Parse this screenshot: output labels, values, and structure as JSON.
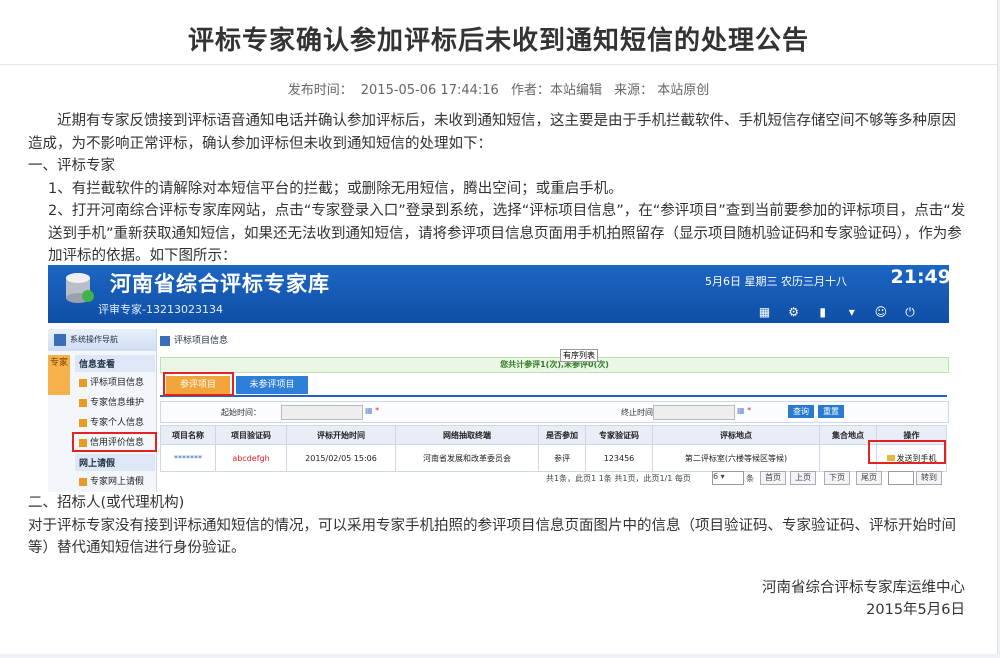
{
  "article": {
    "title": "评标专家确认参加评标后未收到通知短信的处理公告",
    "publish_label": "发布时间：",
    "publish_time": "2015-05-06 17:44:16",
    "author": "作者：本站编辑",
    "source": "来源： 本站原创"
  },
  "body": {
    "intro": "近期有专家反馈接到评标语音通知电话并确认参加评标后，未收到通知短信，这主要是由于手机拦截软件、手机短信存储空间不够等多种原因造成，为不影响正常评标，确认参加评标但未收到通知短信的处理如下：",
    "sec1": "一、评标专家",
    "item1": "1、有拦截软件的请解除对本短信平台的拦截；或删除无用短信，腾出空间；或重启手机。",
    "item2": "2、打开河南综合评标专家库网站，点击“专家登录入口”登录到系统，选择“评标项目信息”，在“参评项目”查到当前要参加的评标项目，点击“发送到手机”重新获取通知短信，如果还无法收到通知短信，请将参评项目信息页面用手机拍照留存（显示项目随机验证码和专家验证码），作为参加评标的依据。如下图所示：",
    "sec2": "二、招标人(或代理机构)",
    "para2": "对于评标专家没有接到评标通知短信的情况，可以采用专家手机拍照的参评项目信息页面图片中的信息（项目验证码、专家验证码、评标开始时间等）替代通知短信进行身份验证。"
  },
  "footer": {
    "org": "河南省综合评标专家库运维中心",
    "date": "2015年5月6日"
  },
  "screenshot": {
    "app_title": "河南省综合评标专家库",
    "user": "评审专家-13213023134",
    "date_text": "5月6日 星期三 农历三月十八",
    "clock": "21:49",
    "side_title": "系统操作导航",
    "side_tab": "专家",
    "menu_group1": "信息查看",
    "menu_items1": [
      "评标项目信息",
      "专家信息维护",
      "专家个人信息",
      "信用评价信息"
    ],
    "menu_group2": "网上请假",
    "menu_items2": [
      "专家网上请假"
    ],
    "main_title": "评标项目信息",
    "banner": "您共计参评1(次),未参评0(次)",
    "tooltip": "有序列表",
    "tab_active": "参评项目",
    "tab_inactive": "未参评项目",
    "form_start_label": "起始时间：",
    "form_end_label": "终止时间：",
    "search_btn": "查询",
    "reset_btn": "重置",
    "columns": [
      "项目名称",
      "项目验证码",
      "评标开始时间",
      "网络抽取终端",
      "是否参加",
      "专家验证码",
      "评标地点",
      "集合地点",
      "操作"
    ],
    "row": [
      "*******",
      "abcdefgh",
      "2015/02/05 15:06",
      "河南省发展和改革委员会",
      "参评",
      "123456",
      "第二评标室(六楼等候区等候)",
      "",
      "发送到手机"
    ],
    "pager_text": "共1条，此页1 1条 共1页，此页1/1   每页",
    "page_size": "6",
    "pager_unit": "条",
    "first": "首页",
    "prev": "上页",
    "next": "下页",
    "last": "尾页",
    "jump": "转到"
  }
}
